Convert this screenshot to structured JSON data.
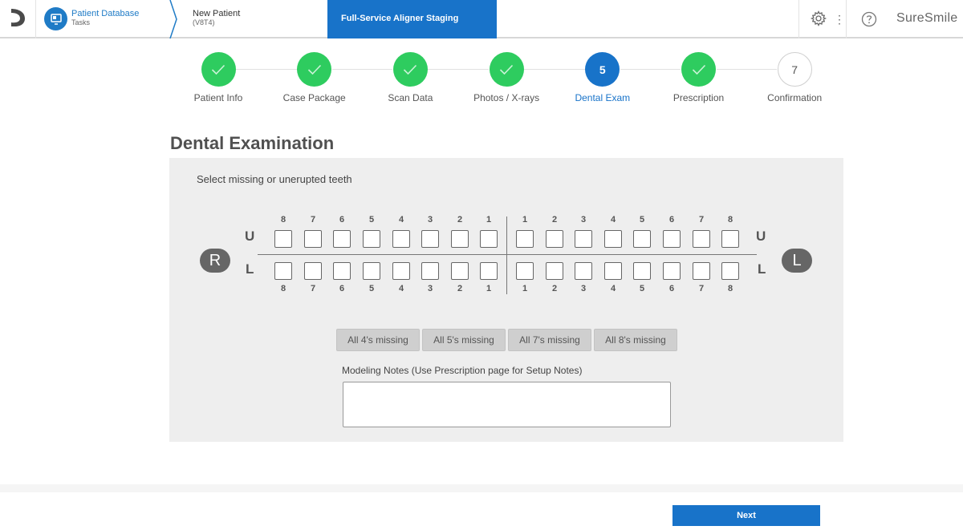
{
  "header": {
    "breadcrumbs": {
      "database_title": "Patient Database",
      "database_sub": "Tasks",
      "patient_title": "New Patient",
      "patient_sub": "(V8T4)",
      "active_title": "Full-Service Aligner Staging"
    },
    "brand": "SureSmile",
    "icons": [
      "logo-icon",
      "monitor-icon",
      "gear-icon",
      "more-vert-icon",
      "help-icon"
    ]
  },
  "steps": [
    {
      "label": "Patient Info",
      "state": "done",
      "number": ""
    },
    {
      "label": "Case Package",
      "state": "done",
      "number": ""
    },
    {
      "label": "Scan Data",
      "state": "done",
      "number": ""
    },
    {
      "label": "Photos / X-rays",
      "state": "done",
      "number": ""
    },
    {
      "label": "Dental Exam",
      "state": "active",
      "number": "5"
    },
    {
      "label": "Prescription",
      "state": "done",
      "number": ""
    },
    {
      "label": "Confirmation",
      "state": "todo",
      "number": "7"
    }
  ],
  "page_title": "Dental Examination",
  "exam": {
    "instruction": "Select missing or unerupted teeth",
    "upper_label": "U",
    "lower_label": "L",
    "right_badge": "R",
    "left_badge": "L",
    "right_numbers": [
      "8",
      "7",
      "6",
      "5",
      "4",
      "3",
      "2",
      "1"
    ],
    "left_numbers": [
      "1",
      "2",
      "3",
      "4",
      "5",
      "6",
      "7",
      "8"
    ],
    "selected_teeth": [],
    "quick_buttons": [
      "All 4's missing",
      "All 5's missing",
      "All 7's missing",
      "All 8's missing"
    ],
    "notes_label": "Modeling Notes (Use Prescription page for Setup Notes)",
    "notes_value": ""
  },
  "footer": {
    "next_label": "Next"
  },
  "colors": {
    "primary": "#1873c9",
    "done": "#2ecc5f",
    "panel": "#eeeeee"
  }
}
